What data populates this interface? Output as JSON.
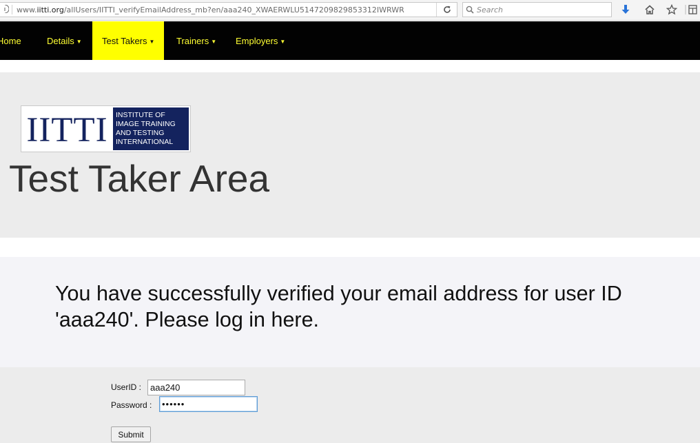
{
  "browser": {
    "url_prefix": "www.",
    "url_host": "iitti.org",
    "url_path": "/allUsers/IITTI_verifyEmailAddress_mb?en/aaa240_XWAERWLU5147209829853312IWRWR",
    "search_placeholder": "Search",
    "icons": [
      "info-icon",
      "reload-icon",
      "search-icon",
      "download-icon",
      "home-icon",
      "star-icon",
      "reader-icon"
    ]
  },
  "nav": {
    "items": [
      {
        "label": "Home"
      },
      {
        "label": "Details"
      },
      {
        "label": "Test Takers"
      },
      {
        "label": "Trainers"
      },
      {
        "label": "Employers"
      }
    ],
    "active": "Test Takers",
    "link_color": "#ffff33",
    "active_bg": "#ffff00"
  },
  "logo": {
    "mark": "IITTI",
    "lines": [
      "INSTITUTE OF",
      "IMAGE TRAINING",
      "AND TESTING",
      "INTERNATIONAL"
    ],
    "brand_color": "#14235e"
  },
  "page": {
    "title": "Test Taker Area",
    "message_line1": "You have successfully verified your email address for user ID",
    "message_line2": "'aaa240'. Please log in here."
  },
  "form": {
    "userid_label": "UserID :",
    "userid_value": "aaa240",
    "password_label": "Password :",
    "password_value": "••••••",
    "submit_label": "Submit"
  }
}
